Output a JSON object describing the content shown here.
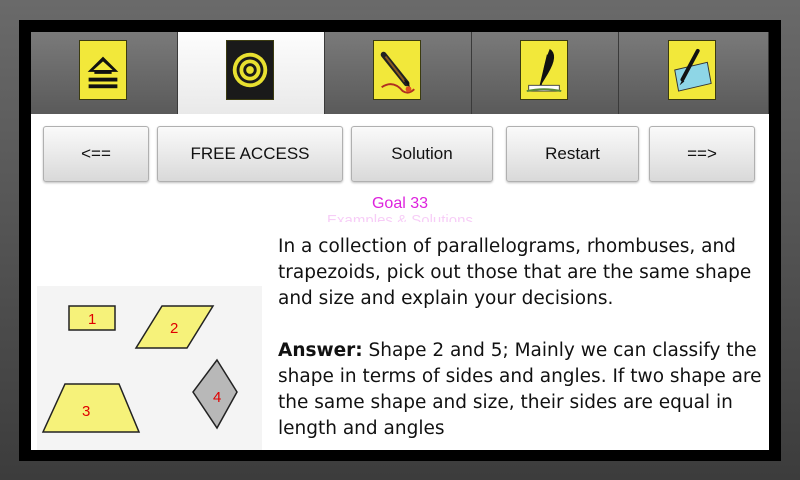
{
  "tabs": [
    {
      "icon": "home-up-arrow-icon",
      "active": false
    },
    {
      "icon": "target-icon",
      "active": true
    },
    {
      "icon": "pencil-icon",
      "active": false
    },
    {
      "icon": "quill-pen-icon",
      "active": false
    },
    {
      "icon": "pen-paper-icon",
      "active": false
    }
  ],
  "buttons": {
    "prev": "<==",
    "free_access": "FREE ACCESS",
    "solution": "Solution",
    "restart": "Restart",
    "next": "==>"
  },
  "goal_title": "Goal 33",
  "subtitle": "Examples & Solutions",
  "problem_text": "In a collection of parallelograms, rhombuses, and trapezoids, pick out those that are the same shape and size and explain your decisions.",
  "answer_label": "Answer:",
  "answer_text": " Shape 2 and 5; Mainly we can classify the shape in terms of sides and angles. If two shape are the same shape and",
  "answer_cutoff": "size, their sides are equal in length and angles",
  "shape_labels": [
    "1",
    "2",
    "3",
    "4"
  ],
  "colors": {
    "shape_fill": "#f6f27a",
    "label_red": "#e00000",
    "goal_magenta": "#dd22dd",
    "rhombus_gray": "#b8b8b8"
  }
}
